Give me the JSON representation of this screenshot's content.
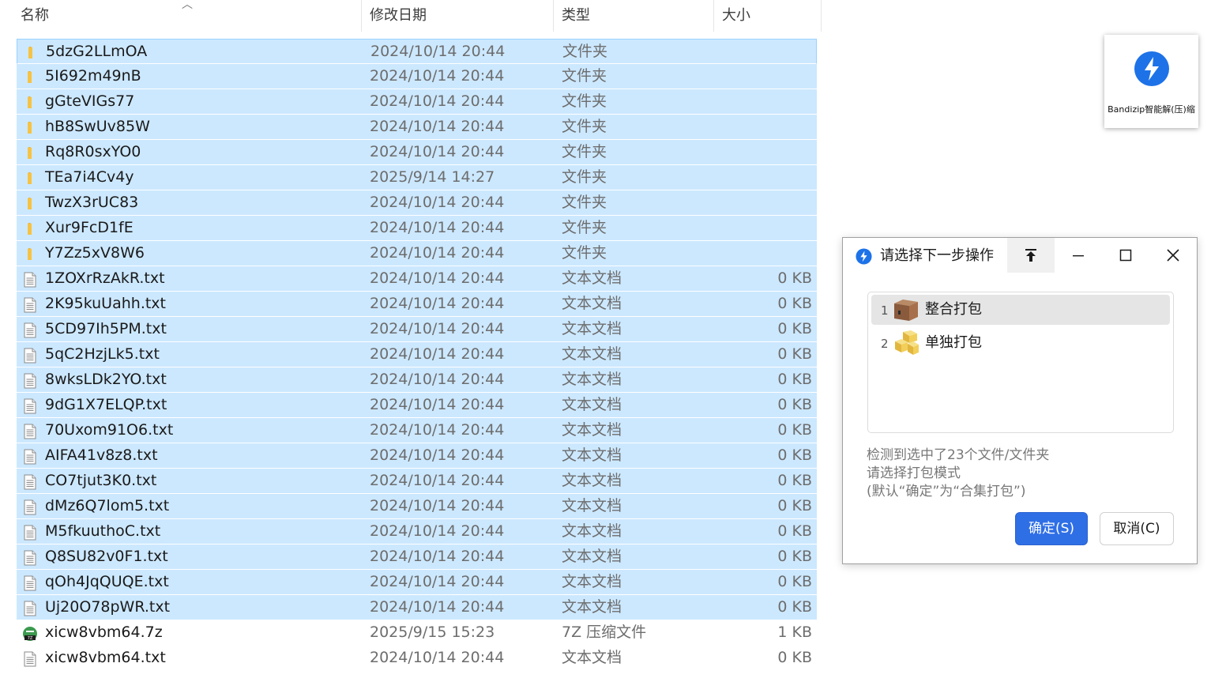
{
  "file_list": {
    "header": {
      "name": "名称",
      "date": "修改日期",
      "type": "类型",
      "size": "大小"
    },
    "rows": [
      {
        "name": "5dzG2LLmOA",
        "date": "2024/10/14 20:44",
        "type": "文件夹",
        "size": "",
        "icon": "folder-icon",
        "selected": true
      },
      {
        "name": "5I692m49nB",
        "date": "2024/10/14 20:44",
        "type": "文件夹",
        "size": "",
        "icon": "folder-icon",
        "selected": true
      },
      {
        "name": "gGteVIGs77",
        "date": "2024/10/14 20:44",
        "type": "文件夹",
        "size": "",
        "icon": "folder-icon",
        "selected": true
      },
      {
        "name": "hB8SwUv85W",
        "date": "2024/10/14 20:44",
        "type": "文件夹",
        "size": "",
        "icon": "folder-icon",
        "selected": true
      },
      {
        "name": "Rq8R0sxYO0",
        "date": "2024/10/14 20:44",
        "type": "文件夹",
        "size": "",
        "icon": "folder-icon",
        "selected": true
      },
      {
        "name": "TEa7i4Cv4y",
        "date": "2025/9/14 14:27",
        "type": "文件夹",
        "size": "",
        "icon": "folder-icon",
        "selected": true
      },
      {
        "name": "TwzX3rUC83",
        "date": "2024/10/14 20:44",
        "type": "文件夹",
        "size": "",
        "icon": "folder-icon",
        "selected": true
      },
      {
        "name": "Xur9FcD1fE",
        "date": "2024/10/14 20:44",
        "type": "文件夹",
        "size": "",
        "icon": "folder-icon",
        "selected": true
      },
      {
        "name": "Y7Zz5xV8W6",
        "date": "2024/10/14 20:44",
        "type": "文件夹",
        "size": "",
        "icon": "folder-icon",
        "selected": true
      },
      {
        "name": "1ZOXrRzAkR.txt",
        "date": "2024/10/14 20:44",
        "type": "文本文档",
        "size": "0 KB",
        "icon": "text-file-icon",
        "selected": true
      },
      {
        "name": "2K95kuUahh.txt",
        "date": "2024/10/14 20:44",
        "type": "文本文档",
        "size": "0 KB",
        "icon": "text-file-icon",
        "selected": true
      },
      {
        "name": "5CD97Ih5PM.txt",
        "date": "2024/10/14 20:44",
        "type": "文本文档",
        "size": "0 KB",
        "icon": "text-file-icon",
        "selected": true
      },
      {
        "name": "5qC2HzjLk5.txt",
        "date": "2024/10/14 20:44",
        "type": "文本文档",
        "size": "0 KB",
        "icon": "text-file-icon",
        "selected": true
      },
      {
        "name": "8wksLDk2YO.txt",
        "date": "2024/10/14 20:44",
        "type": "文本文档",
        "size": "0 KB",
        "icon": "text-file-icon",
        "selected": true
      },
      {
        "name": "9dG1X7ELQP.txt",
        "date": "2024/10/14 20:44",
        "type": "文本文档",
        "size": "0 KB",
        "icon": "text-file-icon",
        "selected": true
      },
      {
        "name": "70Uxom91O6.txt",
        "date": "2024/10/14 20:44",
        "type": "文本文档",
        "size": "0 KB",
        "icon": "text-file-icon",
        "selected": true
      },
      {
        "name": "AIFA41v8z8.txt",
        "date": "2024/10/14 20:44",
        "type": "文本文档",
        "size": "0 KB",
        "icon": "text-file-icon",
        "selected": true
      },
      {
        "name": "CO7tjut3K0.txt",
        "date": "2024/10/14 20:44",
        "type": "文本文档",
        "size": "0 KB",
        "icon": "text-file-icon",
        "selected": true
      },
      {
        "name": "dMz6Q7lom5.txt",
        "date": "2024/10/14 20:44",
        "type": "文本文档",
        "size": "0 KB",
        "icon": "text-file-icon",
        "selected": true
      },
      {
        "name": "M5fkuuthoC.txt",
        "date": "2024/10/14 20:44",
        "type": "文本文档",
        "size": "0 KB",
        "icon": "text-file-icon",
        "selected": true
      },
      {
        "name": "Q8SU82v0F1.txt",
        "date": "2024/10/14 20:44",
        "type": "文本文档",
        "size": "0 KB",
        "icon": "text-file-icon",
        "selected": true
      },
      {
        "name": "qOh4JqQUQE.txt",
        "date": "2024/10/14 20:44",
        "type": "文本文档",
        "size": "0 KB",
        "icon": "text-file-icon",
        "selected": true
      },
      {
        "name": "Uj20O78pWR.txt",
        "date": "2024/10/14 20:44",
        "type": "文本文档",
        "size": "0 KB",
        "icon": "text-file-icon",
        "selected": true
      },
      {
        "name": "xicw8vbm64.7z",
        "date": "2025/9/15 15:23",
        "type": "7Z 压缩文件",
        "size": "1 KB",
        "icon": "7z-archive-icon",
        "selected": false
      },
      {
        "name": "xicw8vbm64.txt",
        "date": "2024/10/14 20:44",
        "type": "文本文档",
        "size": "0 KB",
        "icon": "text-file-icon",
        "selected": false
      }
    ]
  },
  "bandizip_card": {
    "label": "Bandizip智能解(压)缩",
    "icon": "bandizip-logo-icon"
  },
  "dialog": {
    "title": "请选择下一步操作",
    "options": [
      {
        "number": "1",
        "label": "整合打包",
        "icon": "box-icon"
      },
      {
        "number": "2",
        "label": "单独打包",
        "icon": "multiple-boxes-icon"
      }
    ],
    "message_lines": [
      "检测到选中了23个文件/文件夹",
      "请选择打包模式",
      "(默认“确定”为“合集打包”)"
    ],
    "ok_label": "确定(S)",
    "cancel_label": "取消(C)"
  },
  "colors": {
    "selection": "#cce8ff",
    "accent": "#2f6fe6",
    "folder": "#f7c244",
    "bandizip_blue": "#1d72e8"
  }
}
